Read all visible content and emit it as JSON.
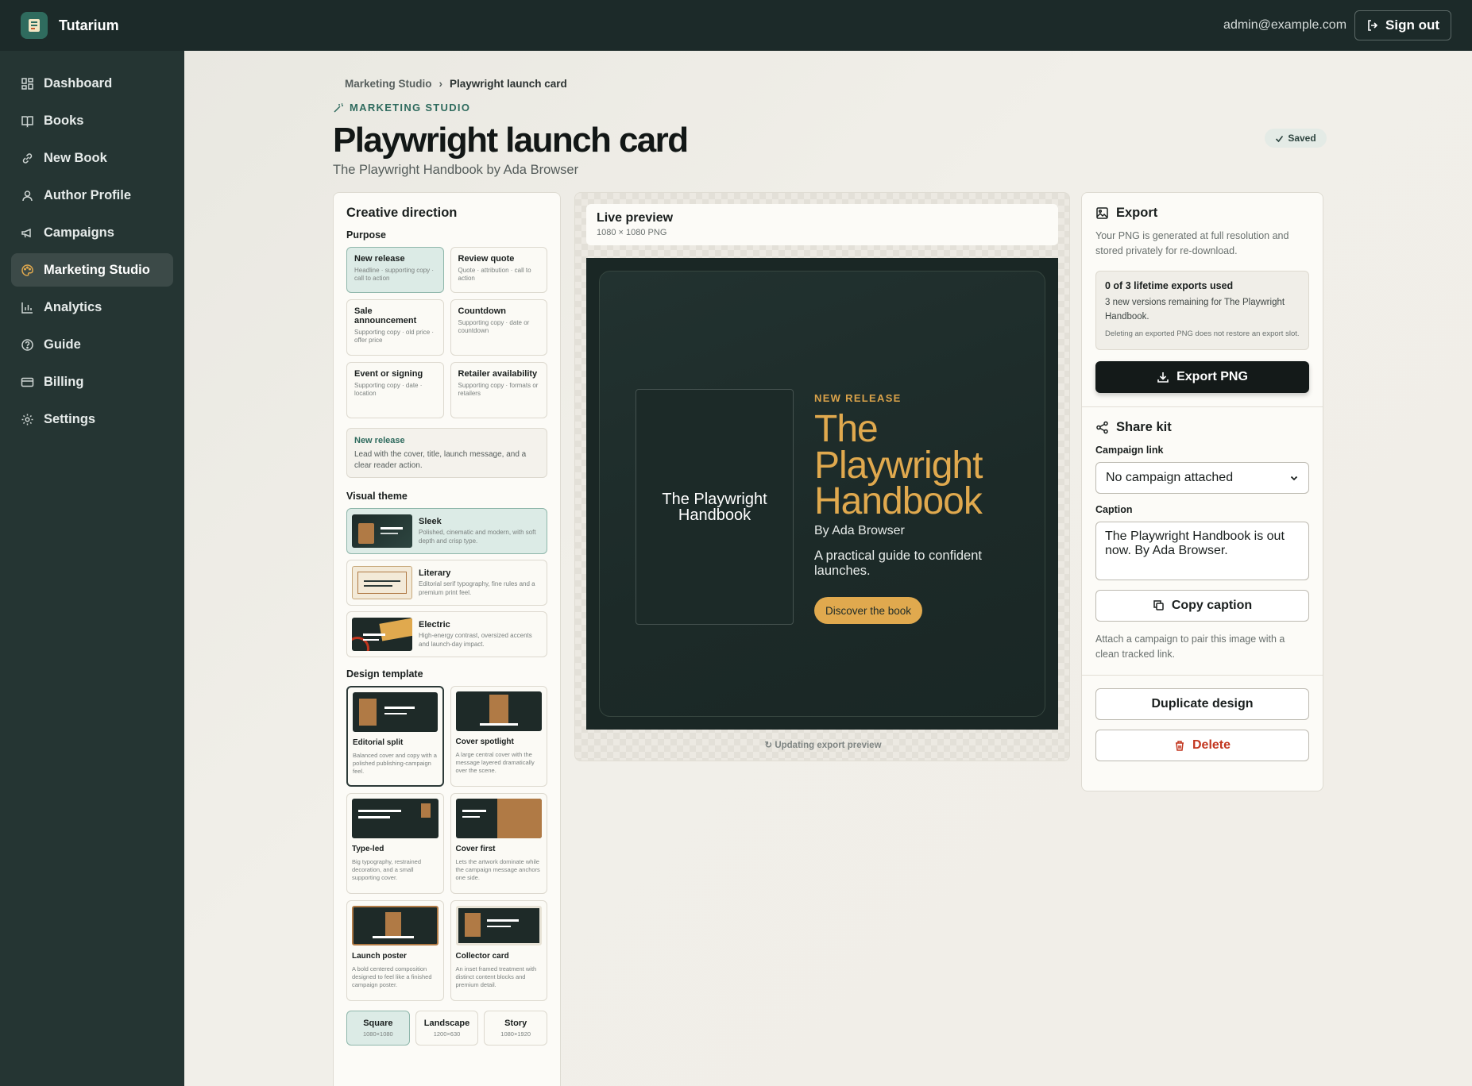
{
  "header": {
    "brand": "Tutarium",
    "email": "admin@example.com",
    "signout_label": "Sign out"
  },
  "sidebar": {
    "items": [
      {
        "label": "Dashboard",
        "icon": "dashboard-icon"
      },
      {
        "label": "Books",
        "icon": "book-icon"
      },
      {
        "label": "New Book",
        "icon": "link-icon"
      },
      {
        "label": "Author Profile",
        "icon": "user-icon"
      },
      {
        "label": "Campaigns",
        "icon": "megaphone-icon"
      },
      {
        "label": "Marketing Studio",
        "icon": "palette-icon",
        "active": true
      },
      {
        "label": "Analytics",
        "icon": "bar-chart-icon"
      },
      {
        "label": "Guide",
        "icon": "help-circle-icon"
      },
      {
        "label": "Billing",
        "icon": "credit-card-icon"
      },
      {
        "label": "Settings",
        "icon": "gear-icon"
      }
    ]
  },
  "breadcrumb": {
    "parent": "Marketing Studio",
    "current": "Playwright launch card"
  },
  "page": {
    "eyebrow": "MARKETING STUDIO",
    "title": "Playwright launch card",
    "subtitle": "The Playwright Handbook by Ada Browser",
    "saved_label": "Saved"
  },
  "creative": {
    "title": "Creative direction",
    "purpose_label": "Purpose",
    "purposes": [
      {
        "title": "New release",
        "desc": "Headline · supporting copy · call to action",
        "selected": true
      },
      {
        "title": "Review quote",
        "desc": "Quote · attribution · call to action"
      },
      {
        "title": "Sale announcement",
        "desc": "Supporting copy · old price · offer price"
      },
      {
        "title": "Countdown",
        "desc": "Supporting copy · date or countdown"
      },
      {
        "title": "Event or signing",
        "desc": "Supporting copy · date · location"
      },
      {
        "title": "Retailer availability",
        "desc": "Supporting copy · formats or retailers"
      }
    ],
    "info": {
      "title": "New release",
      "desc": "Lead with the cover, title, launch message, and a clear reader action."
    },
    "theme_label": "Visual theme",
    "themes": [
      {
        "title": "Sleek",
        "desc": "Polished, cinematic and modern, with soft depth and crisp type.",
        "selected": true
      },
      {
        "title": "Literary",
        "desc": "Editorial serif typography, fine rules and a premium print feel."
      },
      {
        "title": "Electric",
        "desc": "High-energy contrast, oversized accents and launch-day impact."
      }
    ],
    "template_label": "Design template",
    "templates": [
      {
        "title": "Editorial split",
        "desc": "Balanced cover and copy with a polished publishing-campaign feel.",
        "selected": true
      },
      {
        "title": "Cover spotlight",
        "desc": "A large central cover with the message layered dramatically over the scene."
      },
      {
        "title": "Type-led",
        "desc": "Big typography, restrained decoration, and a small supporting cover."
      },
      {
        "title": "Cover first",
        "desc": "Lets the artwork dominate while the campaign message anchors one side."
      },
      {
        "title": "Launch poster",
        "desc": "A bold centered composition designed to feel like a finished campaign poster."
      },
      {
        "title": "Collector card",
        "desc": "An inset framed treatment with distinct content blocks and premium detail."
      }
    ],
    "sizes": [
      {
        "title": "Square",
        "desc": "1080×1080",
        "selected": true
      },
      {
        "title": "Landscape",
        "desc": "1200×630"
      },
      {
        "title": "Story",
        "desc": "1080×1920"
      }
    ]
  },
  "preview": {
    "title": "Live preview",
    "meta": "1080 × 1080 PNG",
    "book_cover_text": "The Playwright Handbook",
    "kicker": "NEW RELEASE",
    "headline": "The Playwright Handbook",
    "author": "By Ada Browser",
    "tagline": "A practical guide to confident launches.",
    "cta": "Discover the book",
    "status": "Updating export preview"
  },
  "export": {
    "title": "Export",
    "desc": "Your PNG is generated at full resolution and stored privately for re-download.",
    "quota_title": "0 of 3 lifetime exports used",
    "quota_desc": "3 new versions remaining for The Playwright Handbook.",
    "quota_note": "Deleting an exported PNG does not restore an export slot.",
    "button": "Export PNG"
  },
  "share": {
    "title": "Share kit",
    "campaign_label": "Campaign link",
    "campaign_value": "No campaign attached",
    "caption_label": "Caption",
    "caption_value": "The Playwright Handbook is out now. By Ada Browser.",
    "copy_button": "Copy caption",
    "hint": "Attach a campaign to pair this image with a clean tracked link."
  },
  "actions": {
    "duplicate": "Duplicate design",
    "delete": "Delete"
  },
  "colors": {
    "sidebar": "#253533",
    "topbar": "#1c2a29",
    "accent": "#2f6b5e",
    "gold": "#e0a94e",
    "danger": "#c2361f"
  }
}
